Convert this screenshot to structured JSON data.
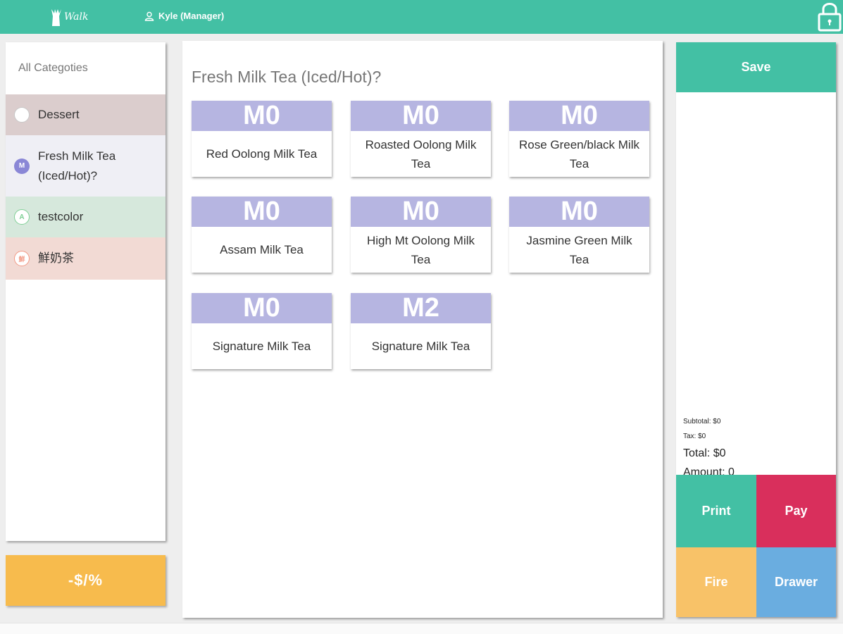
{
  "header": {
    "logo_text": "Walk",
    "user_label": "Kyle (Manager)",
    "brand_color": "#43c0a4"
  },
  "categories": {
    "all_label": "All Categoties",
    "items": [
      {
        "label": "Dessert",
        "badge": "",
        "bg": "#dbcdcd",
        "badge_color": "#c8c8c8"
      },
      {
        "label": "Fresh Milk Tea (Iced/Hot)?",
        "badge": "M",
        "bg": "#efeff5",
        "badge_color": "#8a87d6"
      },
      {
        "label": "testcolor",
        "badge": "A",
        "bg": "#d6e8dc",
        "badge_color": "#7fcf95"
      },
      {
        "label": "鮮奶茶",
        "badge": "鮮",
        "bg": "#f2dad4",
        "badge_color": "#f29a86"
      }
    ]
  },
  "discount_label": "-$/%",
  "menu": {
    "title": "Fresh Milk Tea (Iced/Hot)?",
    "items": [
      {
        "code": "M0",
        "name": "Red Oolong Milk Tea"
      },
      {
        "code": "M0",
        "name": "Roasted Oolong Milk Tea"
      },
      {
        "code": "M0",
        "name": "Rose Green/black Milk Tea"
      },
      {
        "code": "M0",
        "name": "Assam Milk Tea"
      },
      {
        "code": "M0",
        "name": "High Mt Oolong Milk Tea"
      },
      {
        "code": "M0",
        "name": "Jasmine Green Milk Tea"
      },
      {
        "code": "M0",
        "name": "Signature Milk Tea"
      },
      {
        "code": "M2",
        "name": "Signature Milk Tea"
      }
    ]
  },
  "order": {
    "save_label": "Save",
    "subtotal": "Subtotal: $0",
    "tax": "Tax: $0",
    "total": "Total: $0",
    "amount": "Amount: 0",
    "actions": {
      "print": "Print",
      "pay": "Pay",
      "fire": "Fire",
      "drawer": "Drawer"
    }
  }
}
